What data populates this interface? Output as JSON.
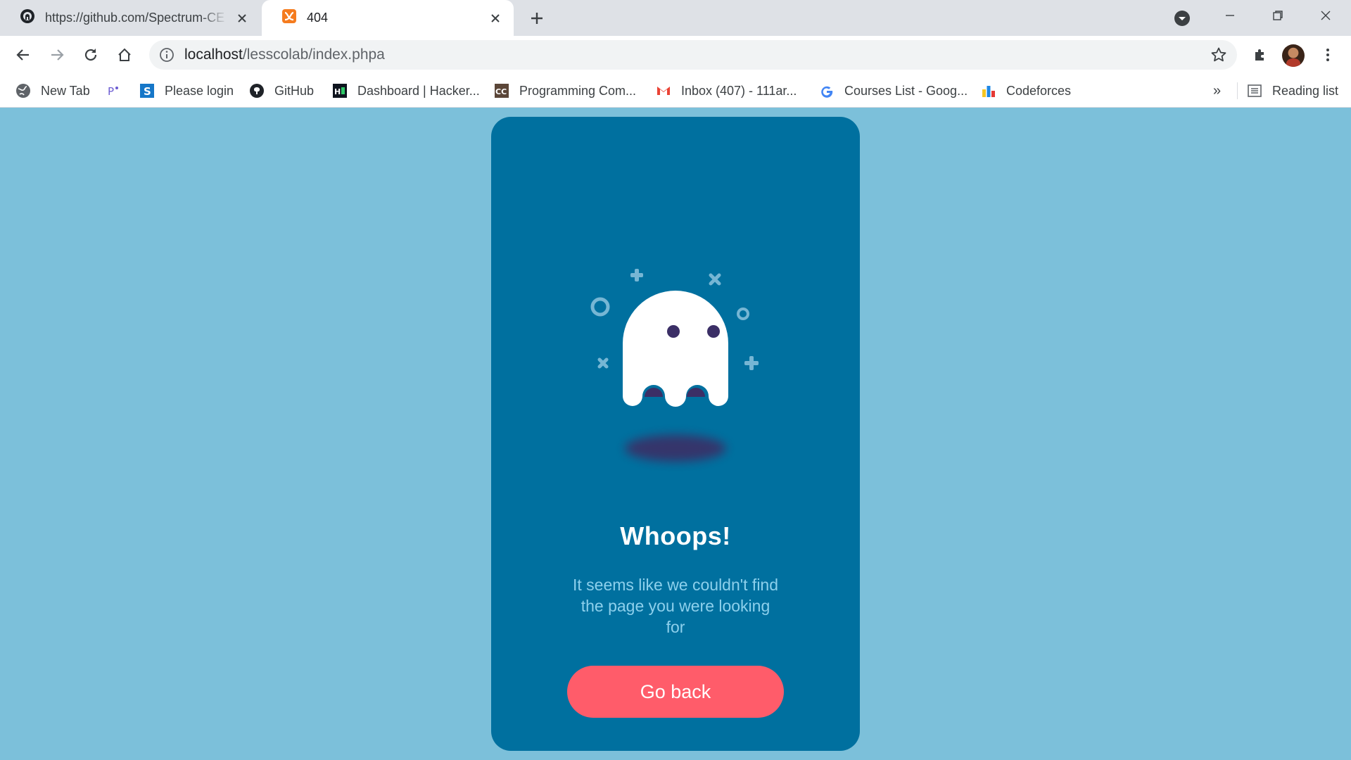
{
  "browser": {
    "tabs": [
      {
        "title": "https://github.com/Spectrum-CE",
        "active": false
      },
      {
        "title": "404",
        "active": true
      }
    ],
    "address": {
      "host": "localhost",
      "path": "/lesscolab/index.phpa"
    },
    "bookmarks": [
      {
        "label": "New Tab"
      },
      {
        "label": ""
      },
      {
        "label": "Please login"
      },
      {
        "label": "GitHub"
      },
      {
        "label": "Dashboard | Hacker..."
      },
      {
        "label": "Programming Com..."
      },
      {
        "label": "Inbox (407) - 111ar..."
      },
      {
        "label": "Courses List - Goog..."
      },
      {
        "label": "Codeforces"
      }
    ],
    "overflow_label": "»",
    "reading_list_label": "Reading list"
  },
  "page": {
    "heading": "Whoops!",
    "message": "It seems like we couldn't find the page you were looking for",
    "button_label": "Go back"
  },
  "colors": {
    "background": "#7cc0da",
    "card": "#00709f",
    "ghost": "#ffffff",
    "ghost_features": "#3b2f66",
    "button": "#ff5c6a",
    "message_text": "#8dd0ec"
  },
  "icons": [
    "github-tab-icon",
    "xampp-tab-icon",
    "close-icon",
    "plus-icon",
    "back-arrow-icon",
    "forward-arrow-icon",
    "reload-icon",
    "home-icon",
    "info-icon",
    "star-icon",
    "puzzle-icon",
    "menu-dots-icon",
    "ghost-icon"
  ]
}
